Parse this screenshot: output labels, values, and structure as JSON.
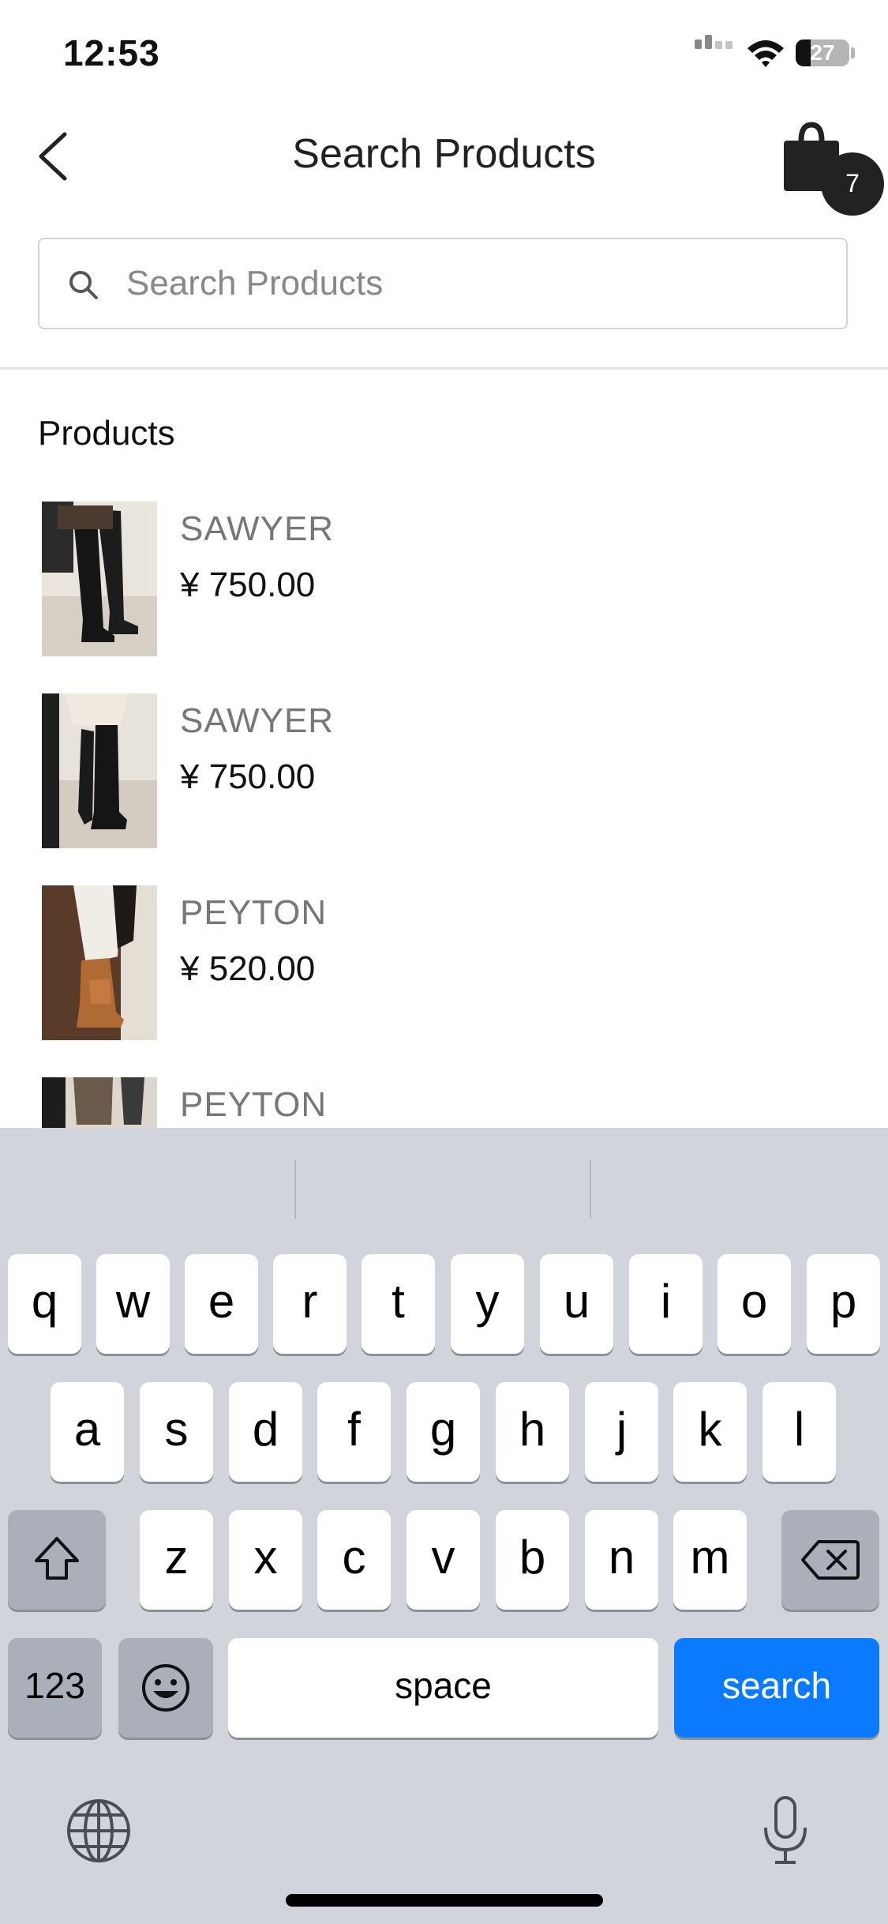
{
  "status_bar": {
    "time": "12:53",
    "battery": "27"
  },
  "header": {
    "title": "Search Products",
    "cart_count": "7"
  },
  "search": {
    "placeholder": "Search Products",
    "value": ""
  },
  "section_title": "Products",
  "products": [
    {
      "name": "SAWYER",
      "price": "¥ 750.00",
      "image": "black-over-knee-boots"
    },
    {
      "name": "SAWYER",
      "price": "¥ 750.00",
      "image": "black-over-knee-boots"
    },
    {
      "name": "PEYTON",
      "price": "¥ 520.00",
      "image": "tan-ankle-boots"
    },
    {
      "name": "PEYTON",
      "price": "",
      "image": "ankle-boots-partial"
    }
  ],
  "keyboard": {
    "row1": [
      "q",
      "w",
      "e",
      "r",
      "t",
      "y",
      "u",
      "i",
      "o",
      "p"
    ],
    "row2": [
      "a",
      "s",
      "d",
      "f",
      "g",
      "h",
      "j",
      "k",
      "l"
    ],
    "row3": [
      "z",
      "x",
      "c",
      "v",
      "b",
      "n",
      "m"
    ],
    "numbers_label": "123",
    "space_label": "space",
    "action_label": "search"
  },
  "colors": {
    "accent": "#0a7aff",
    "keyboard_bg": "#d1d4db",
    "badge": "#222222"
  }
}
